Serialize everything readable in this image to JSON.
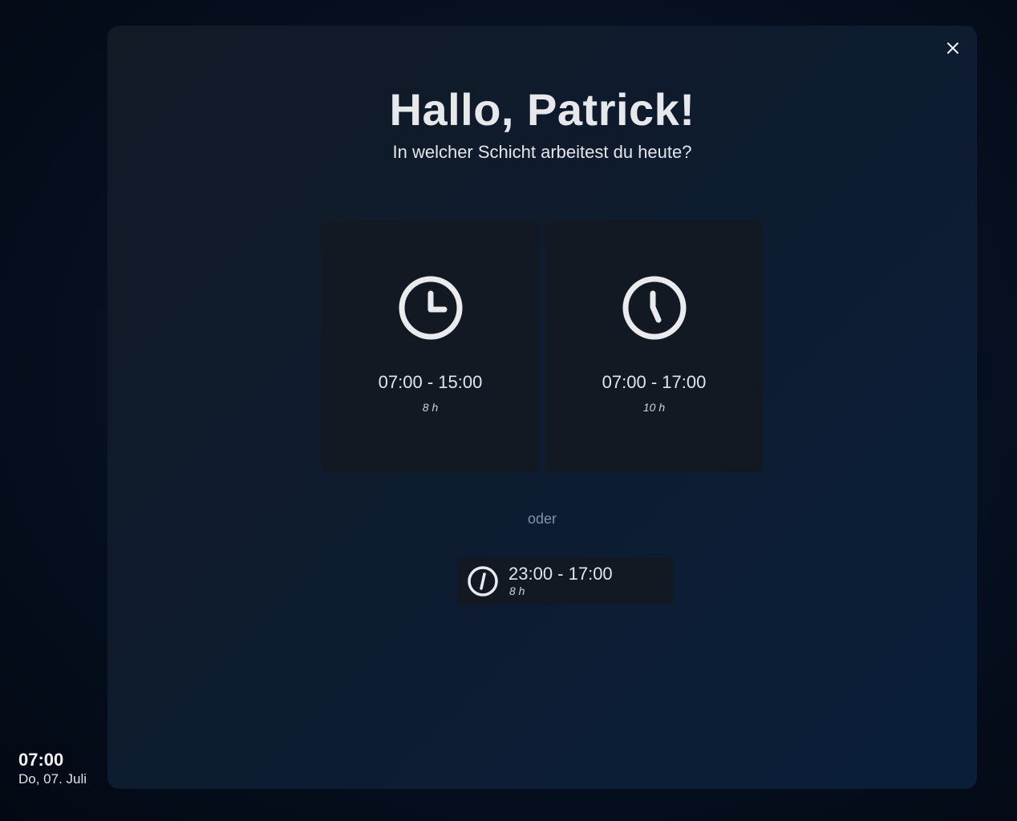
{
  "modal": {
    "title": "Hallo, Patrick!",
    "subtitle": "In welcher Schicht arbeitest du heute?",
    "close_icon": "close-icon"
  },
  "shifts": [
    {
      "range": "07:00 - 15:00",
      "hours": "8 h",
      "icon": "clock-icon"
    },
    {
      "range": "07:00 - 17:00",
      "hours": "10 h",
      "icon": "clock-icon"
    }
  ],
  "divider_text": "oder",
  "alternative_shift": {
    "range": "23:00 - 17:00",
    "hours": "8 h",
    "icon": "clock-icon"
  },
  "status": {
    "time": "07:00",
    "date": "Do, 07. Juli"
  },
  "colors": {
    "background": "#050d19",
    "card": "#121923",
    "text": "#e6e8ec",
    "muted": "#8092ad"
  }
}
